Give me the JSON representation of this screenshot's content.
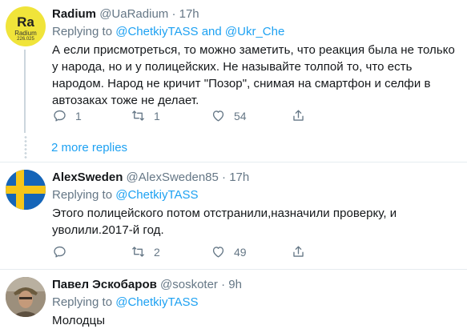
{
  "tweets": [
    {
      "name": "Radium",
      "handle": "@UaRadium",
      "dot": "·",
      "time": "17h",
      "avatar": {
        "letters": "Ra",
        "label": "Radium",
        "number": "226.025",
        "corner": "88"
      },
      "replying_prefix": "Replying to",
      "replying_targets": [
        "@ChetkiyTASS",
        "@Ukr_Che"
      ],
      "replying_joiner": "and",
      "text": "А если присмотреться, то можно заметить, что реакция была не только у народа, но и у полицейских. Не называйте толпой то, что есть народом. Народ не кричит \"Позор\", снимая на смартфон и селфи в автозаках тоже не делает.",
      "replies": "1",
      "retweets": "1",
      "likes": "54"
    },
    {
      "name": "AlexSweden",
      "handle": "@AlexSweden85",
      "dot": "·",
      "time": "17h",
      "replying_prefix": "Replying to",
      "replying_targets": [
        "@ChetkiyTASS"
      ],
      "text": "Этого полицейского потом отстранили,назначили проверку, и уволили.2017-й год.",
      "replies": "",
      "retweets": "2",
      "likes": "49"
    },
    {
      "name": "Павел Эскобаров",
      "handle": "@soskoter",
      "dot": "·",
      "time": "9h",
      "replying_prefix": "Replying to",
      "replying_targets": [
        "@ChetkiyTASS"
      ],
      "text": "Молодцы"
    }
  ],
  "more_replies": "2 more replies",
  "colors": {
    "accent": "#1da1f2",
    "muted": "#657786",
    "text": "#14171a",
    "border": "#e6ecf0"
  },
  "icons": [
    "reply-icon",
    "retweet-icon",
    "like-icon",
    "share-icon"
  ]
}
